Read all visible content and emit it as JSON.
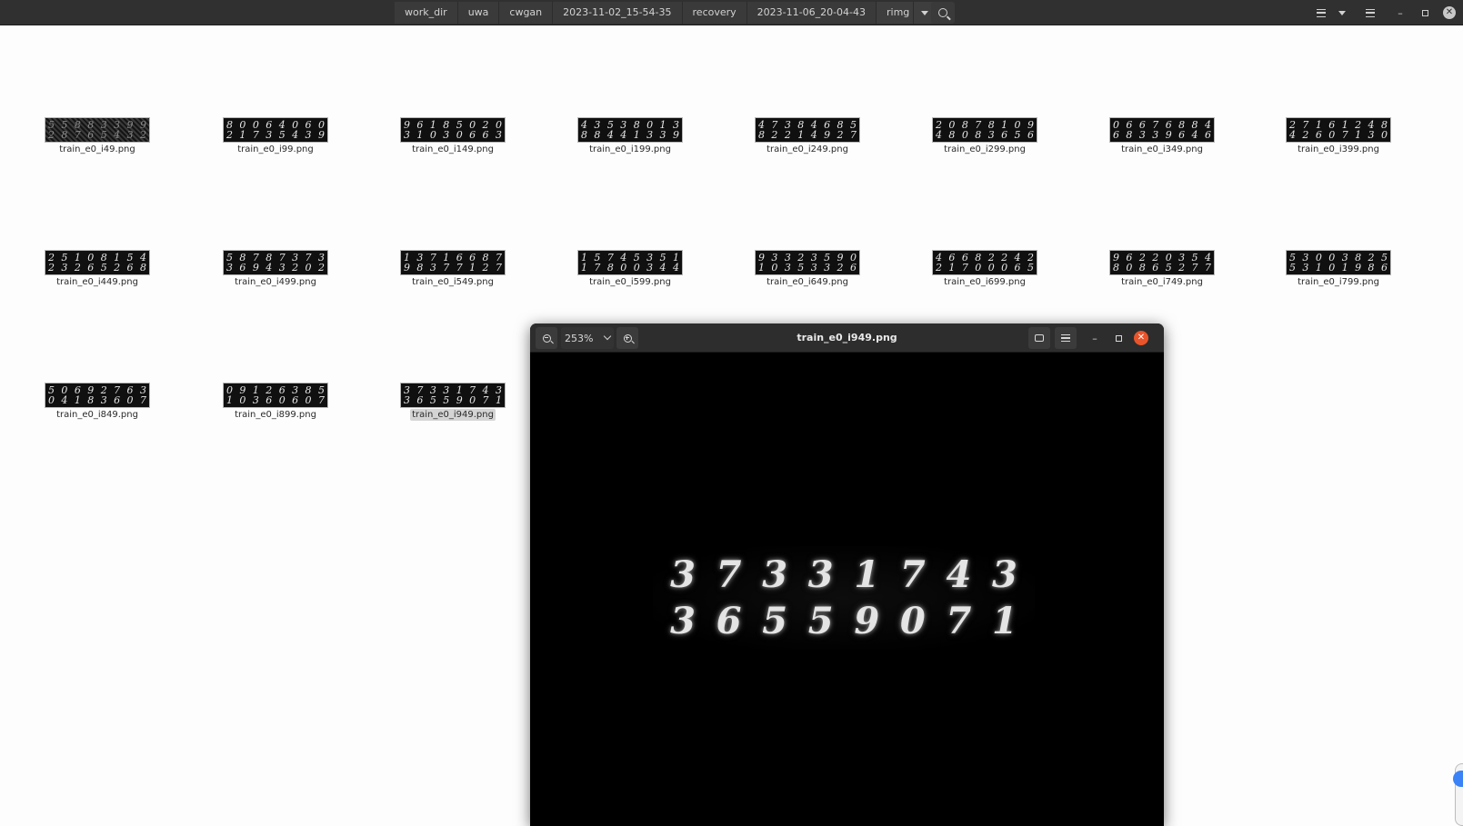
{
  "breadcrumbs": [
    "work_dir",
    "uwa",
    "cwgan",
    "2023-11-02_15-54-35",
    "recovery",
    "2023-11-06_20-04-43",
    "rimg"
  ],
  "files": [
    {
      "name": "train_e0_i49.png",
      "thumb": [
        "55883399",
        "28765432"
      ],
      "noise": true
    },
    {
      "name": "train_e0_i99.png",
      "thumb": [
        "80064060",
        "21735439"
      ]
    },
    {
      "name": "train_e0_i149.png",
      "thumb": [
        "96185020",
        "31030663"
      ]
    },
    {
      "name": "train_e0_i199.png",
      "thumb": [
        "43538013",
        "88441339"
      ]
    },
    {
      "name": "train_e0_i249.png",
      "thumb": [
        "47384685",
        "82214927"
      ]
    },
    {
      "name": "train_e0_i299.png",
      "thumb": [
        "20878109",
        "48083656"
      ]
    },
    {
      "name": "train_e0_i349.png",
      "thumb": [
        "06676884",
        "68339646"
      ]
    },
    {
      "name": "train_e0_i399.png",
      "thumb": [
        "27161248",
        "42607130"
      ]
    },
    {
      "name": "train_e0_i449.png",
      "thumb": [
        "25108154",
        "23265268"
      ]
    },
    {
      "name": "train_e0_i499.png",
      "thumb": [
        "58787373",
        "36943202"
      ]
    },
    {
      "name": "train_e0_i549.png",
      "thumb": [
        "13716687",
        "98377127"
      ]
    },
    {
      "name": "train_e0_i599.png",
      "thumb": [
        "15745351",
        "17800344"
      ]
    },
    {
      "name": "train_e0_i649.png",
      "thumb": [
        "93323590",
        "10353326"
      ]
    },
    {
      "name": "train_e0_i699.png",
      "thumb": [
        "46682242",
        "21700065"
      ]
    },
    {
      "name": "train_e0_i749.png",
      "thumb": [
        "96220354",
        "80865277"
      ]
    },
    {
      "name": "train_e0_i799.png",
      "thumb": [
        "53003825",
        "53101986"
      ]
    },
    {
      "name": "train_e0_i849.png",
      "thumb": [
        "50692763",
        "04183607"
      ]
    },
    {
      "name": "train_e0_i899.png",
      "thumb": [
        "09126385",
        "10360607"
      ]
    },
    {
      "name": "train_e0_i949.png",
      "thumb": [
        "37331743",
        "36559071"
      ],
      "selected": true
    }
  ],
  "viewer": {
    "title": "train_e0_i949.png",
    "zoom": "253%",
    "digits_top": [
      "3",
      "7",
      "3",
      "3",
      "1",
      "7",
      "4",
      "3"
    ],
    "digits_bottom": [
      "3",
      "6",
      "5",
      "5",
      "9",
      "0",
      "7",
      "1"
    ]
  },
  "icons": {
    "search": "search-icon",
    "view_list": "list-view-icon",
    "menu": "hamburger-menu-icon",
    "close": "close-icon"
  },
  "colors": {
    "header_bg": "#303030",
    "viewer_close": "#e9542b",
    "selection": "#d4d4d4"
  }
}
